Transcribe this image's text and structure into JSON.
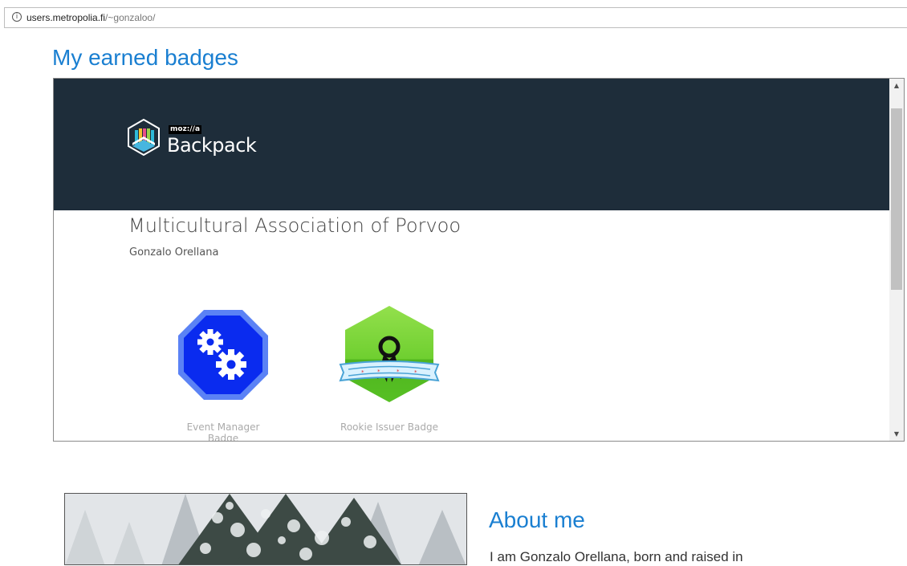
{
  "browser": {
    "url_host": "users.metropolia.fi",
    "url_path": "/~gonzaloo/",
    "info_icon": "i"
  },
  "page": {
    "title": "My earned badges"
  },
  "backpack": {
    "brand_tag": "moz://a",
    "brand_name": "Backpack",
    "collection_title": "Multicultural Association of Porvoo",
    "owner": "Gonzalo Orellana",
    "badges": [
      {
        "name": "Event Manager Badge",
        "icon": "gears-octagon-icon",
        "color": "#1a3ff2"
      },
      {
        "name": "Rookie Issuer Badge",
        "icon": "ribbon-hexagon-icon",
        "color": "#7fd63a"
      }
    ],
    "scrollbar": {
      "up_arrow": "▲",
      "down_arrow": "▼"
    }
  },
  "about": {
    "title": "About me",
    "text": "I am Gonzalo Orellana, born and raised in"
  }
}
